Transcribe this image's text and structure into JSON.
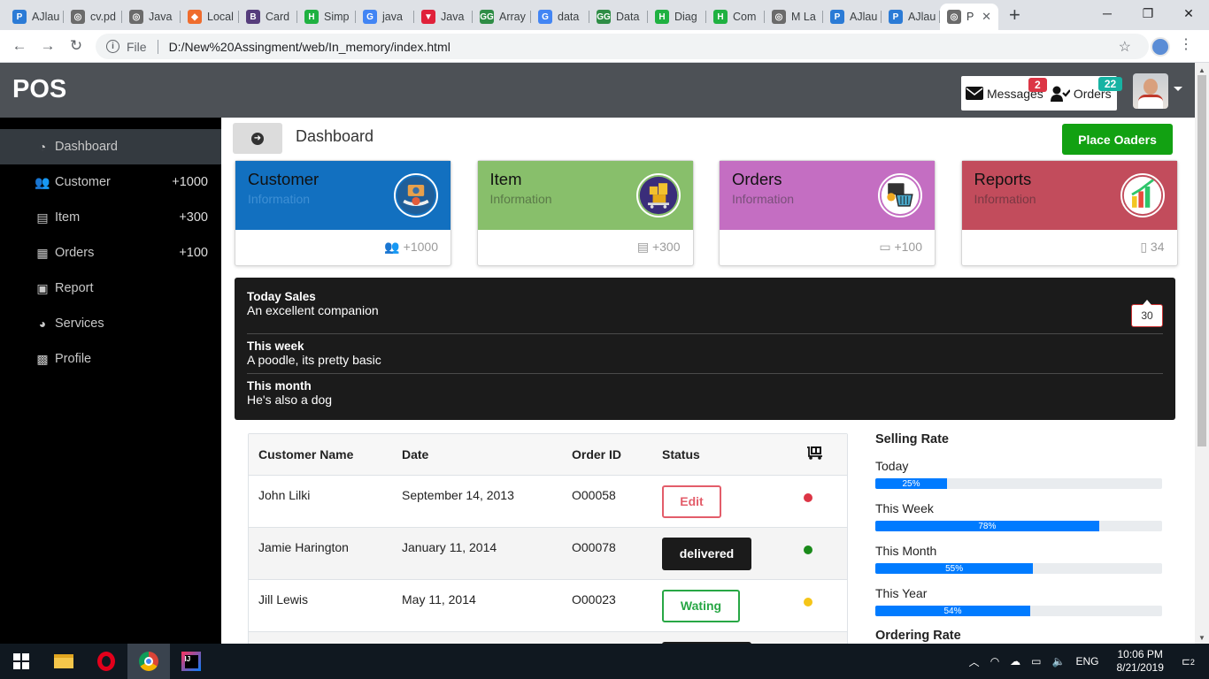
{
  "browser": {
    "tabs": [
      {
        "label": "AJlau",
        "fav": "P",
        "color": "#2b7bd6"
      },
      {
        "label": "cv.pd",
        "fav": "◎",
        "color": "#6b6b6b"
      },
      {
        "label": "Java",
        "fav": "◎",
        "color": "#6b6b6b"
      },
      {
        "label": "Local",
        "fav": "◆",
        "color": "#ef6c2d"
      },
      {
        "label": "Card",
        "fav": "B",
        "color": "#563d7c"
      },
      {
        "label": "Simp",
        "fav": "H",
        "color": "#1fb141"
      },
      {
        "label": "java",
        "fav": "G",
        "color": "#4285f4"
      },
      {
        "label": "Java",
        "fav": "▼",
        "color": "#e0213a"
      },
      {
        "label": "Array",
        "fav": "GG",
        "color": "#2f8d46"
      },
      {
        "label": "data",
        "fav": "G",
        "color": "#4285f4"
      },
      {
        "label": "Data",
        "fav": "GG",
        "color": "#2f8d46"
      },
      {
        "label": "Diag",
        "fav": "H",
        "color": "#1fb141"
      },
      {
        "label": "Com",
        "fav": "H",
        "color": "#1fb141"
      },
      {
        "label": "M La",
        "fav": "◎",
        "color": "#6b6b6b"
      },
      {
        "label": "AJlau",
        "fav": "P",
        "color": "#2b7bd6"
      },
      {
        "label": "AJlau",
        "fav": "P",
        "color": "#2b7bd6"
      },
      {
        "label": "P",
        "fav": "◎",
        "color": "#6b6b6b",
        "active": true
      }
    ],
    "new_tab": "+",
    "url_scheme": "File",
    "url": "D:/New%20Assingment/web/In_memory/index.html"
  },
  "app": {
    "brand": "POS",
    "messages_label": "Messages",
    "messages_count": "2",
    "orders_label": "Orders",
    "orders_count": "22",
    "page_title": "Dashboard",
    "place_button": "Place Oaders"
  },
  "sidebar": [
    {
      "label": "Dashboard",
      "icon": "dashboard-icon",
      "glyph": "◔",
      "count": "",
      "active": true
    },
    {
      "label": "Customer",
      "icon": "users-icon",
      "glyph": "👥",
      "count": "+1000"
    },
    {
      "label": "Item",
      "icon": "boxes-icon",
      "glyph": "▤",
      "count": "+300"
    },
    {
      "label": "Orders",
      "icon": "truck-icon",
      "glyph": "▦",
      "count": "+100"
    },
    {
      "label": "Report",
      "icon": "id-card-icon",
      "glyph": "▣",
      "count": ""
    },
    {
      "label": "Services",
      "icon": "pie-chart-icon",
      "glyph": "◕",
      "count": ""
    },
    {
      "label": "Profile",
      "icon": "briefcase-icon",
      "glyph": "▩",
      "count": ""
    }
  ],
  "cards": [
    {
      "title": "Customer",
      "sub": "Information",
      "value": "+1000",
      "color": "#1270c0",
      "text": "#111",
      "sub_color": "#3e8fd4",
      "icon": "customer-icon",
      "foot_glyph": "👥"
    },
    {
      "title": "Item",
      "sub": "Information",
      "value": "+300",
      "color": "#88bf6b",
      "text": "#111",
      "sub_color": "#5a7a48",
      "icon": "item-icon",
      "foot_glyph": "▤"
    },
    {
      "title": "Orders",
      "sub": "Information",
      "value": "+100",
      "color": "#c46ec2",
      "text": "#111",
      "sub_color": "#7a4f7a",
      "icon": "cart-icon",
      "foot_glyph": "▭"
    },
    {
      "title": "Reports",
      "sub": "Information",
      "value": "34",
      "color": "#c24c5c",
      "text": "#111",
      "sub_color": "#7a3843",
      "icon": "chart-icon",
      "foot_glyph": "▯"
    }
  ],
  "sales": [
    {
      "title": "Today Sales",
      "text": "An excellent companion"
    },
    {
      "title": "This week",
      "text": "A poodle, its pretty basic"
    },
    {
      "title": "This month",
      "text": "He's also a dog"
    }
  ],
  "sales_badge": "30",
  "orders_table": {
    "headers": [
      "Customer Name",
      "Date",
      "Order ID",
      "Status"
    ],
    "rows": [
      {
        "name": "John Lilki",
        "date": "September 14, 2013",
        "id": "O00058",
        "status": "Edit",
        "style": "edit",
        "dot": "#dc3545"
      },
      {
        "name": "Jamie Harington",
        "date": "January 11, 2014",
        "id": "O00078",
        "status": "delivered",
        "style": "dark",
        "dot": "#1a8a1a"
      },
      {
        "name": "Jill Lewis",
        "date": "May 11, 2014",
        "id": "O00023",
        "status": "Wating",
        "style": "wait",
        "dot": "#f5c518"
      }
    ]
  },
  "selling_rate": {
    "title": "Selling Rate",
    "bars": [
      {
        "label": "Today",
        "value": 25,
        "text": "25%"
      },
      {
        "label": "This Week",
        "value": 78,
        "text": "78%"
      },
      {
        "label": "This Month",
        "value": 55,
        "text": "55%"
      },
      {
        "label": "This Year",
        "value": 54,
        "text": "54%"
      }
    ],
    "next_title": "Ordering Rate"
  },
  "taskbar": {
    "lang": "ENG",
    "time": "10:06 PM",
    "date": "8/21/2019",
    "notif": "2"
  }
}
